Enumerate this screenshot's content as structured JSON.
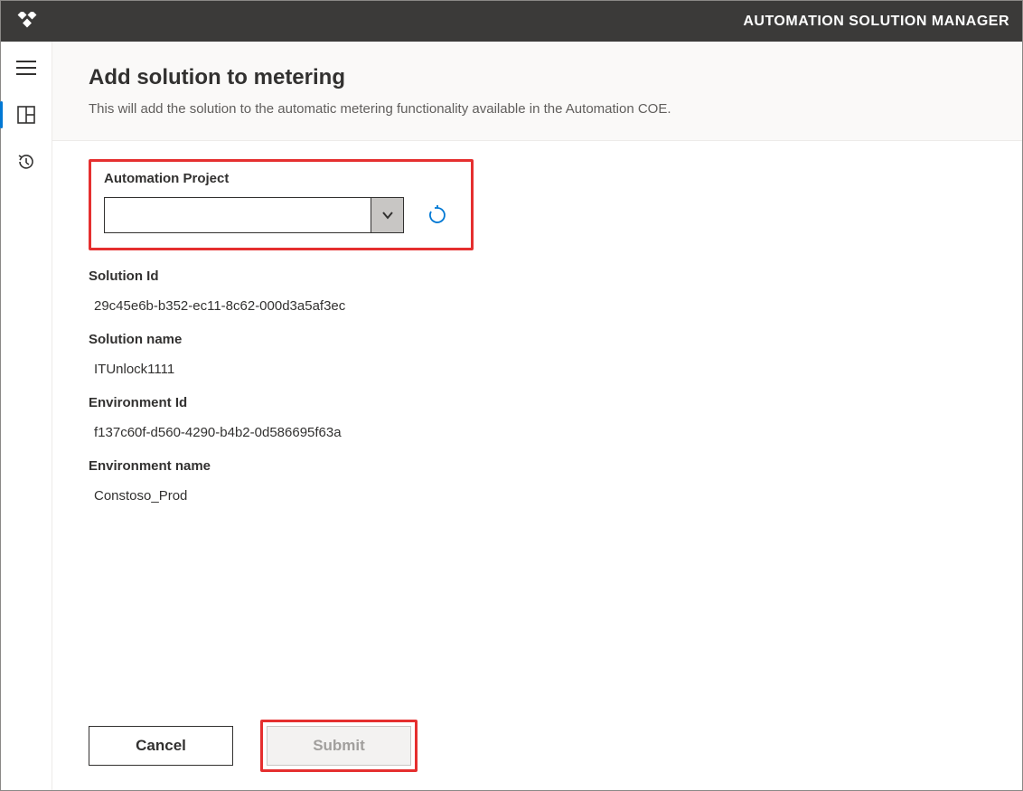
{
  "app": {
    "title": "AUTOMATION SOLUTION MANAGER"
  },
  "page": {
    "heading": "Add solution to metering",
    "subtitle": "This will add the solution to the automatic metering functionality available in the Automation COE."
  },
  "form": {
    "automation_project": {
      "label": "Automation Project",
      "value": ""
    },
    "solution_id": {
      "label": "Solution Id",
      "value": "29c45e6b-b352-ec11-8c62-000d3a5af3ec"
    },
    "solution_name": {
      "label": "Solution name",
      "value": "ITUnlock1111"
    },
    "environment_id": {
      "label": "Environment Id",
      "value": "f137c60f-d560-4290-b4b2-0d586695f63a"
    },
    "environment_name": {
      "label": "Environment name",
      "value": "Constoso_Prod"
    }
  },
  "buttons": {
    "cancel": "Cancel",
    "submit": "Submit"
  }
}
